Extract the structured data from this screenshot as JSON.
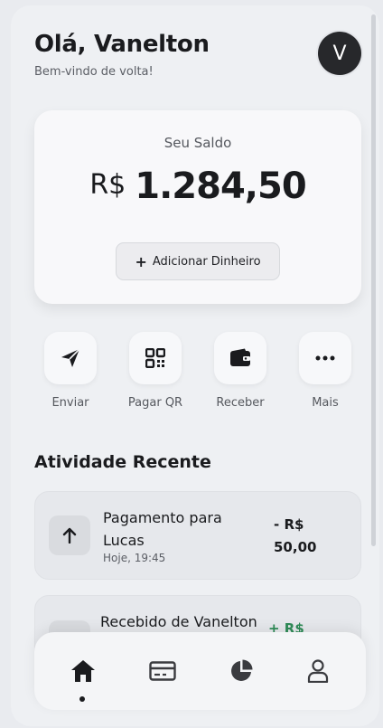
{
  "header": {
    "greeting": "Olá, Vanelton",
    "subtitle": "Bem-vindo de volta!",
    "avatar_initial": "V"
  },
  "balance": {
    "label": "Seu Saldo",
    "currency": "R$",
    "amount": "1.284,50",
    "add_plus": "+",
    "add_label": "Adicionar Dinheiro"
  },
  "actions": [
    {
      "label": "Enviar",
      "icon": "send-icon"
    },
    {
      "label": "Pagar QR",
      "icon": "qr-code-icon"
    },
    {
      "label": "Receber",
      "icon": "wallet-icon"
    },
    {
      "label": "Mais",
      "icon": "more-icon"
    }
  ],
  "activity": {
    "title": "Atividade Recente",
    "transactions": [
      {
        "title": "Pagamento para Lucas",
        "date": "Hoje, 19:45",
        "amount": "- R$ 50,00",
        "icon": "arrow-up-icon"
      },
      {
        "title": "Recebido de Vanelton",
        "amount": "+ R$",
        "icon": "arrow-down-icon"
      }
    ]
  },
  "nav": [
    {
      "name": "home",
      "icon": "home-icon",
      "active": true
    },
    {
      "name": "cards",
      "icon": "card-icon",
      "active": false
    },
    {
      "name": "analytics",
      "icon": "pie-chart-icon",
      "active": false
    },
    {
      "name": "profile",
      "icon": "user-icon",
      "active": false
    }
  ],
  "colors": {
    "primary": "#1a1b1e",
    "positive": "#2e8b57",
    "background": "#eef0f3"
  }
}
